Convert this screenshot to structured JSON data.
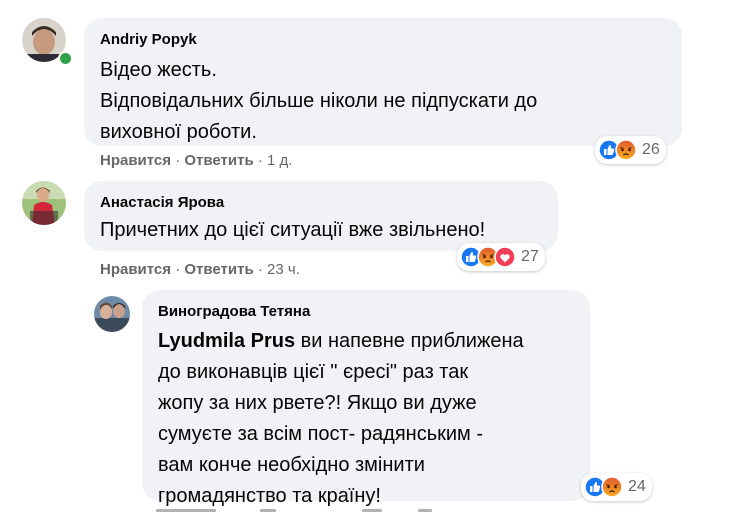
{
  "comments": [
    {
      "author": "Andriy Popyk",
      "lines": [
        "Відео жесть.",
        "Відповідальних більше ніколи не підпускати до",
        "виховної роботи."
      ],
      "like": "Нравится",
      "reply": "Ответить",
      "time": "1 д.",
      "reactions": 26,
      "online": true
    },
    {
      "author": "Анастасія Ярова",
      "lines": [
        "Причетних до цієї ситуації вже звільнено!"
      ],
      "like": "Нравится",
      "reply": "Ответить",
      "time": "23 ч.",
      "reactions": 27
    }
  ],
  "reply": {
    "author": "Виноградова Тетяна",
    "mention": "Lyudmila Prus",
    "first_line_rest": " ви напевне приближена",
    "lines": [
      "до виконавців цієї \" єресі\" раз так",
      "жопу за них рвете?! Якщо ви дуже",
      "сумуєте за всім пост- радянським -",
      "вам конче необхідно змінити",
      "громадянство та країну!"
    ],
    "reactions": 24
  },
  "separator": "·",
  "colors": {
    "like": "#1877f2",
    "angry": "#e4572e",
    "love": "#f33e58",
    "bubble": "#f0f2f5",
    "meta": "#65676b"
  }
}
